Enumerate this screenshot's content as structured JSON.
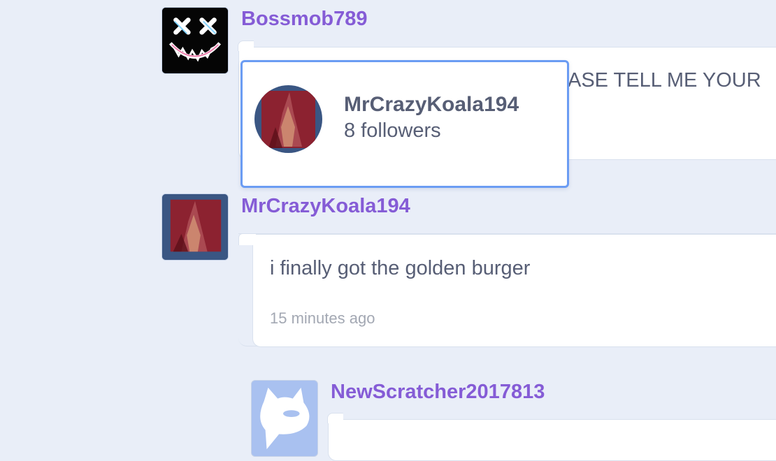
{
  "comments": [
    {
      "username": "Bossmob789",
      "text_visible": "ASE TELL ME YOUR"
    },
    {
      "username": "MrCrazyKoala194",
      "text": "i finally got the golden burger",
      "timestamp": "15 minutes ago"
    },
    {
      "username": "NewScratcher2017813"
    }
  ],
  "hovercard": {
    "username": "MrCrazyKoala194",
    "followers": "8 followers"
  },
  "colors": {
    "background": "#e9eef8",
    "username": "#855cd6",
    "text": "#575e75",
    "timestamp": "#a3a8b3",
    "hovercard_border": "#6b9cf3"
  },
  "icons": {
    "bossmob_avatar": "x-eyes-smiley-avatar",
    "koala_avatar": "red-figure-avatar",
    "newscratcher_avatar": "scratch-cat-avatar"
  }
}
